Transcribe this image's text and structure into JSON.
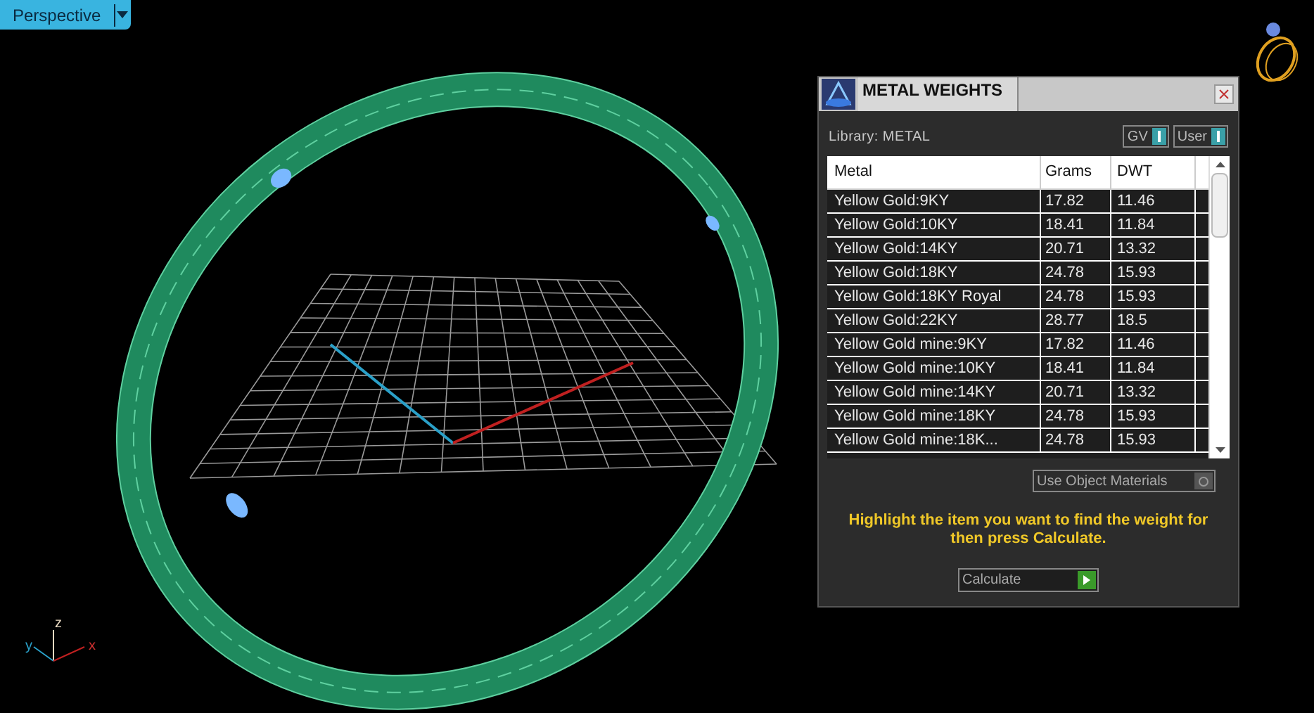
{
  "viewport": {
    "view_menu": "Perspective",
    "axes": {
      "z": "z",
      "y": "y",
      "x": "x"
    }
  },
  "panel": {
    "title": "METAL WEIGHTS",
    "library": "Library: METAL",
    "toggles": [
      {
        "label": "GV",
        "on": true
      },
      {
        "label": "User",
        "on": true
      }
    ],
    "columns": [
      "Metal",
      "Grams",
      "DWT"
    ],
    "rows": [
      [
        "Yellow Gold:9KY",
        "17.82",
        "11.46"
      ],
      [
        "Yellow Gold:10KY",
        "18.41",
        "11.84"
      ],
      [
        "Yellow Gold:14KY",
        "20.71",
        "13.32"
      ],
      [
        "Yellow Gold:18KY",
        "24.78",
        "15.93"
      ],
      [
        "Yellow Gold:18KY Royal",
        "24.78",
        "15.93"
      ],
      [
        "Yellow Gold:22KY",
        "28.77",
        "18.5"
      ],
      [
        "Yellow Gold mine:9KY",
        "17.82",
        "11.46"
      ],
      [
        "Yellow Gold mine:10KY",
        "18.41",
        "11.84"
      ],
      [
        "Yellow Gold mine:14KY",
        "20.71",
        "13.32"
      ],
      [
        "Yellow Gold mine:18KY",
        "24.78",
        "15.93"
      ],
      [
        "Yellow Gold mine:18K...",
        "24.78",
        "15.93"
      ]
    ],
    "use_object_materials": {
      "label": "Use Object Materials",
      "checked": false
    },
    "hint": "Highlight the item you want to find the weight for then press Calculate.",
    "calculate": "Calculate"
  }
}
